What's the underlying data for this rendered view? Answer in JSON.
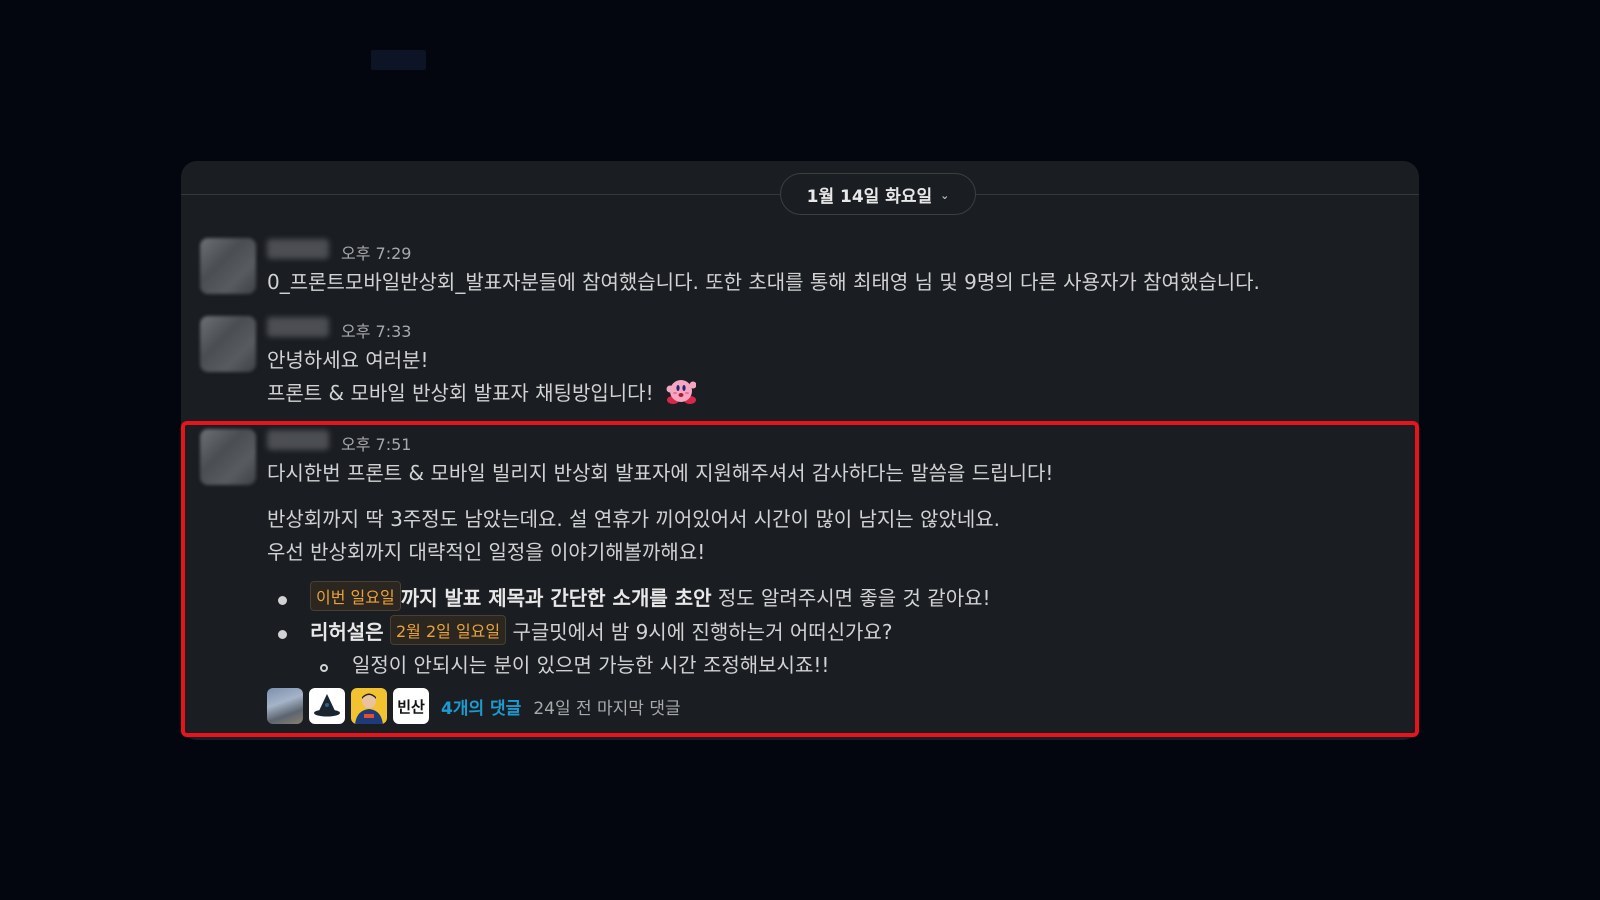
{
  "date_divider": {
    "label": "1월 14일 화요일"
  },
  "messages": [
    {
      "time": "오후 7:29",
      "lines": [
        "0_프론트모바일반상회_발표자분들에 참여했습니다. 또한 초대를 통해 최태영 님 및 9명의 다른 사용자가 참여했습니다."
      ]
    },
    {
      "time": "오후 7:33",
      "lines": [
        "안녕하세요 여러분!",
        "프론트 & 모바일 반상회 발표자 채팅방입니다!"
      ],
      "emoji": "kirby-emoji"
    },
    {
      "time": "오후 7:51",
      "lines": [
        "다시한번 프론트 & 모바일 빌리지 반상회 발표자에 지원해주셔서 감사하다는 말씀을 드립니다!",
        "반상회까지 딱 3주정도 남았는데요. 설 연휴가 끼어있어서 시간이 많이 남지는 않았네요.",
        "우선 반상회까지 대략적인 일정을 이야기해볼까해요!"
      ],
      "bullets": [
        {
          "chip": "이번 일요일",
          "bold": "까지 발표 제목과 간단한 소개를 초안",
          "rest": " 정도 알려주시면 좋을 것 같아요!"
        },
        {
          "bold": "리허설은",
          "chip": "2월 2일 일요일",
          "rest": " 구글밋에서 밤 9시에 진행하는거 어떠신가요?"
        }
      ],
      "sub_bullet": "일정이 안되시는 분이 있으면 가능한 시간 조정해보시죠!!",
      "thread": {
        "avatar4_text": "빈산",
        "reply_count": "4개의 댓글",
        "last_reply": "24일 전 마지막 댓글"
      }
    }
  ],
  "colors": {
    "background": "#04060f",
    "panel": "#1a1d21",
    "highlight_border": "#e8141c",
    "link": "#1d9bd1",
    "chip_text": "#e8a33c"
  }
}
